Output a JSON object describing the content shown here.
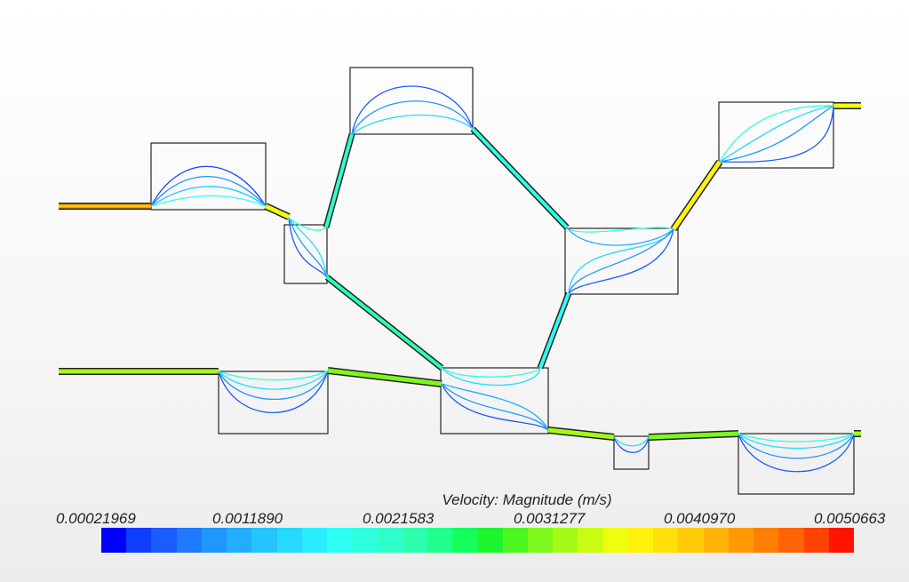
{
  "legend": {
    "title": "Velocity: Magnitude (m/s)",
    "ticks": [
      "0.00021969",
      "0.0011890",
      "0.0021583",
      "0.0031277",
      "0.0040970",
      "0.0050663"
    ],
    "colors": [
      "#0000ff",
      "#0f3dff",
      "#1a5cff",
      "#1f7aff",
      "#2096ff",
      "#22adff",
      "#25c4ff",
      "#27d9ff",
      "#29ecff",
      "#2cfff3",
      "#2effdf",
      "#2fffca",
      "#2dffaf",
      "#21ff8c",
      "#12ff5c",
      "#1df52f",
      "#4df521",
      "#7df81a",
      "#a4fa15",
      "#cafc12",
      "#eefe0e",
      "#fff20c",
      "#ffdf0a",
      "#ffca08",
      "#ffb306",
      "#ff9a05",
      "#ff7f04",
      "#ff6303",
      "#ff4102",
      "#ff1400"
    ]
  }
}
